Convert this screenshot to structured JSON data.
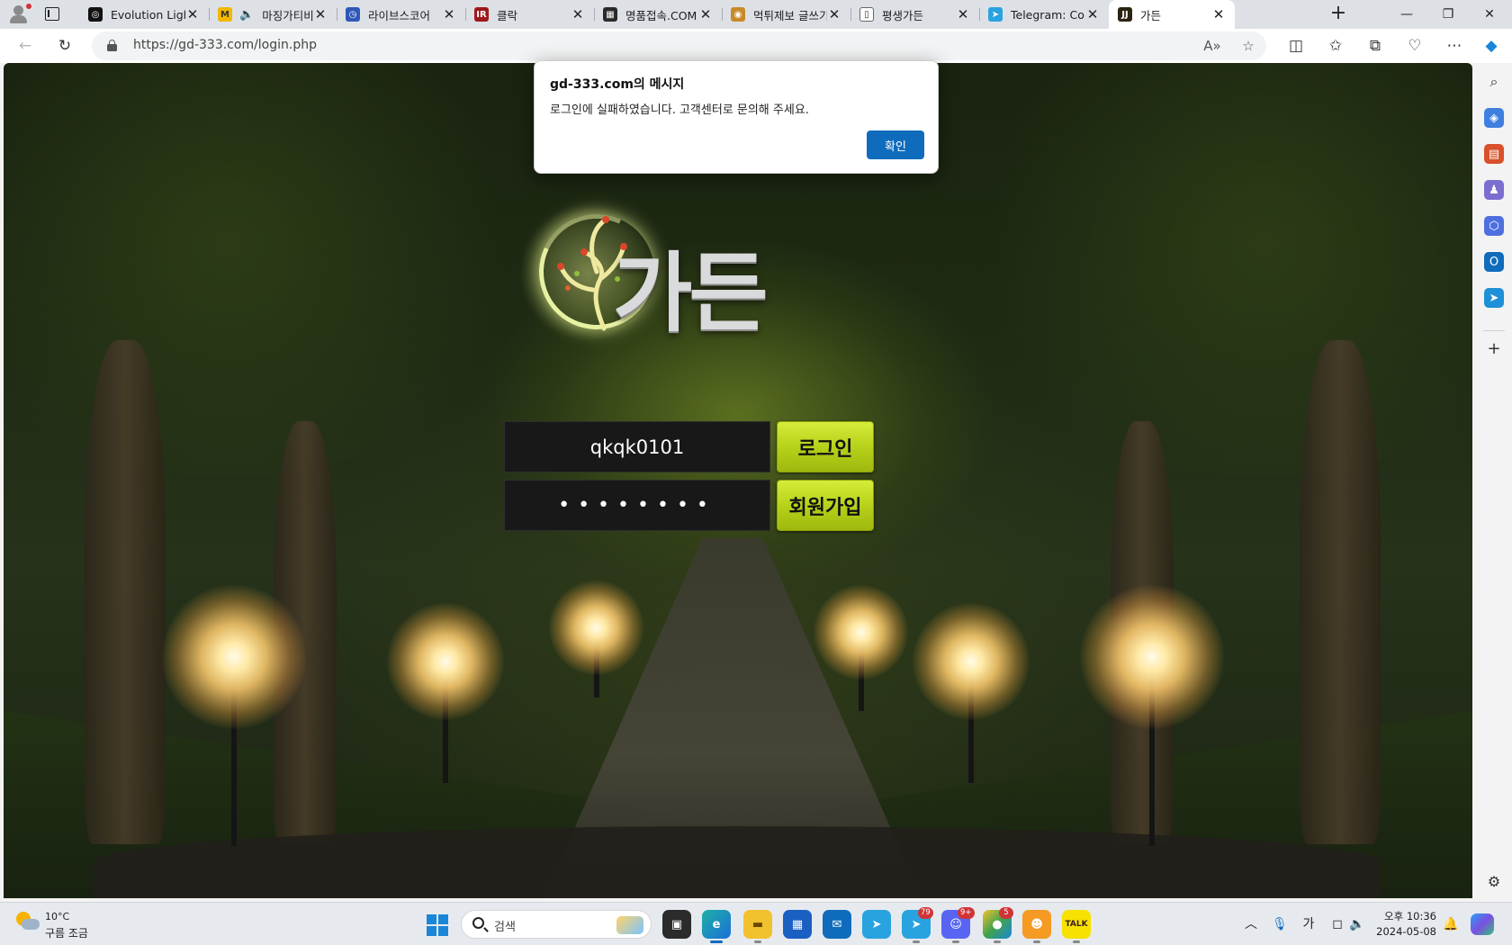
{
  "browser": {
    "tabs": [
      {
        "title": "Evolution Lightni",
        "favicon": "evolution-logo",
        "fav_color": "#111111",
        "fav_text": "◎"
      },
      {
        "title": "마징가티비",
        "favicon": "mazinga-logo",
        "fav_color": "#f2b800",
        "fav_text": "M",
        "audio": "speaker-icon"
      },
      {
        "title": "라이브스코어",
        "favicon": "livescore-logo",
        "fav_color": "#2f57b8",
        "fav_text": "◷"
      },
      {
        "title": "클락",
        "favicon": "clock-site-logo",
        "fav_color": "#a0171b",
        "fav_text": "IR"
      },
      {
        "title": "명품접속.COM",
        "favicon": "myungpum-logo",
        "fav_color": "#2a2a2a",
        "fav_text": "▦"
      },
      {
        "title": "먹튀제보 글쓰기",
        "favicon": "muktwi-logo",
        "fav_color": "#c98a2a",
        "fav_text": "◉"
      },
      {
        "title": "평생가든",
        "favicon": "page-icon",
        "fav_color": "#ffffff",
        "fav_text": "▯"
      },
      {
        "title": "Telegram: Conta",
        "favicon": "telegram-logo",
        "fav_color": "#29a3e0",
        "fav_text": "➤"
      },
      {
        "title": "가든",
        "favicon": "garden-logo",
        "fav_color": "#2b2412",
        "fav_text": "JJ",
        "active": true
      }
    ],
    "url": "https://gd-333.com/login.php"
  },
  "dialog": {
    "title": "gd-333.com의 메시지",
    "message": "로그인에 실패하였습니다. 고객센터로 문의해 주세요.",
    "ok_label": "확인"
  },
  "page": {
    "brand_text": "가든",
    "login_form": {
      "username_value": "qkqk0101",
      "password_mask": "••••••••",
      "login_label": "로그인",
      "signup_label": "회원가입"
    },
    "accent_color": "#b7d21a"
  },
  "taskbar": {
    "weather": {
      "temp": "10°C",
      "desc": "구름 조금"
    },
    "search_label": "검색",
    "badges": {
      "telegram": "79",
      "discord": "9+",
      "other": "5"
    },
    "ime": "가",
    "clock": {
      "time": "오후 10:36",
      "date": "2024-05-08"
    }
  }
}
